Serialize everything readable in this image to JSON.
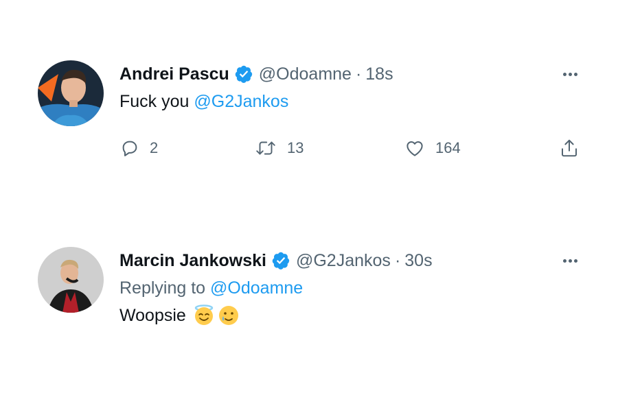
{
  "tweets": [
    {
      "author_name": "Andrei Pascu",
      "handle": "@Odoamne",
      "separator": "·",
      "time": "18s",
      "text_prefix": "Fuck you ",
      "text_mention": "@G2Jankos",
      "actions": {
        "replies": "2",
        "retweets": "13",
        "likes": "164"
      },
      "icons": {
        "verified": "verified-badge-icon",
        "more": "more-options-icon",
        "reply": "reply-icon",
        "retweet": "retweet-icon",
        "like": "heart-icon",
        "share": "share-icon"
      }
    },
    {
      "author_name": "Marcin Jankowski",
      "handle": "@G2Jankos",
      "separator": "·",
      "time": "30s",
      "replying_prefix": "Replying to ",
      "replying_mention": "@Odoamne",
      "text": "Woopsie",
      "emojis": [
        "smiling-face-with-halo",
        "smiling-face-with-tear"
      ],
      "icons": {
        "verified": "verified-badge-icon",
        "more": "more-options-icon"
      }
    }
  ],
  "colors": {
    "link": "#1d9bf0",
    "secondary_text": "#536471",
    "primary_text": "#0f1419",
    "verified": "#1d9bf0"
  }
}
